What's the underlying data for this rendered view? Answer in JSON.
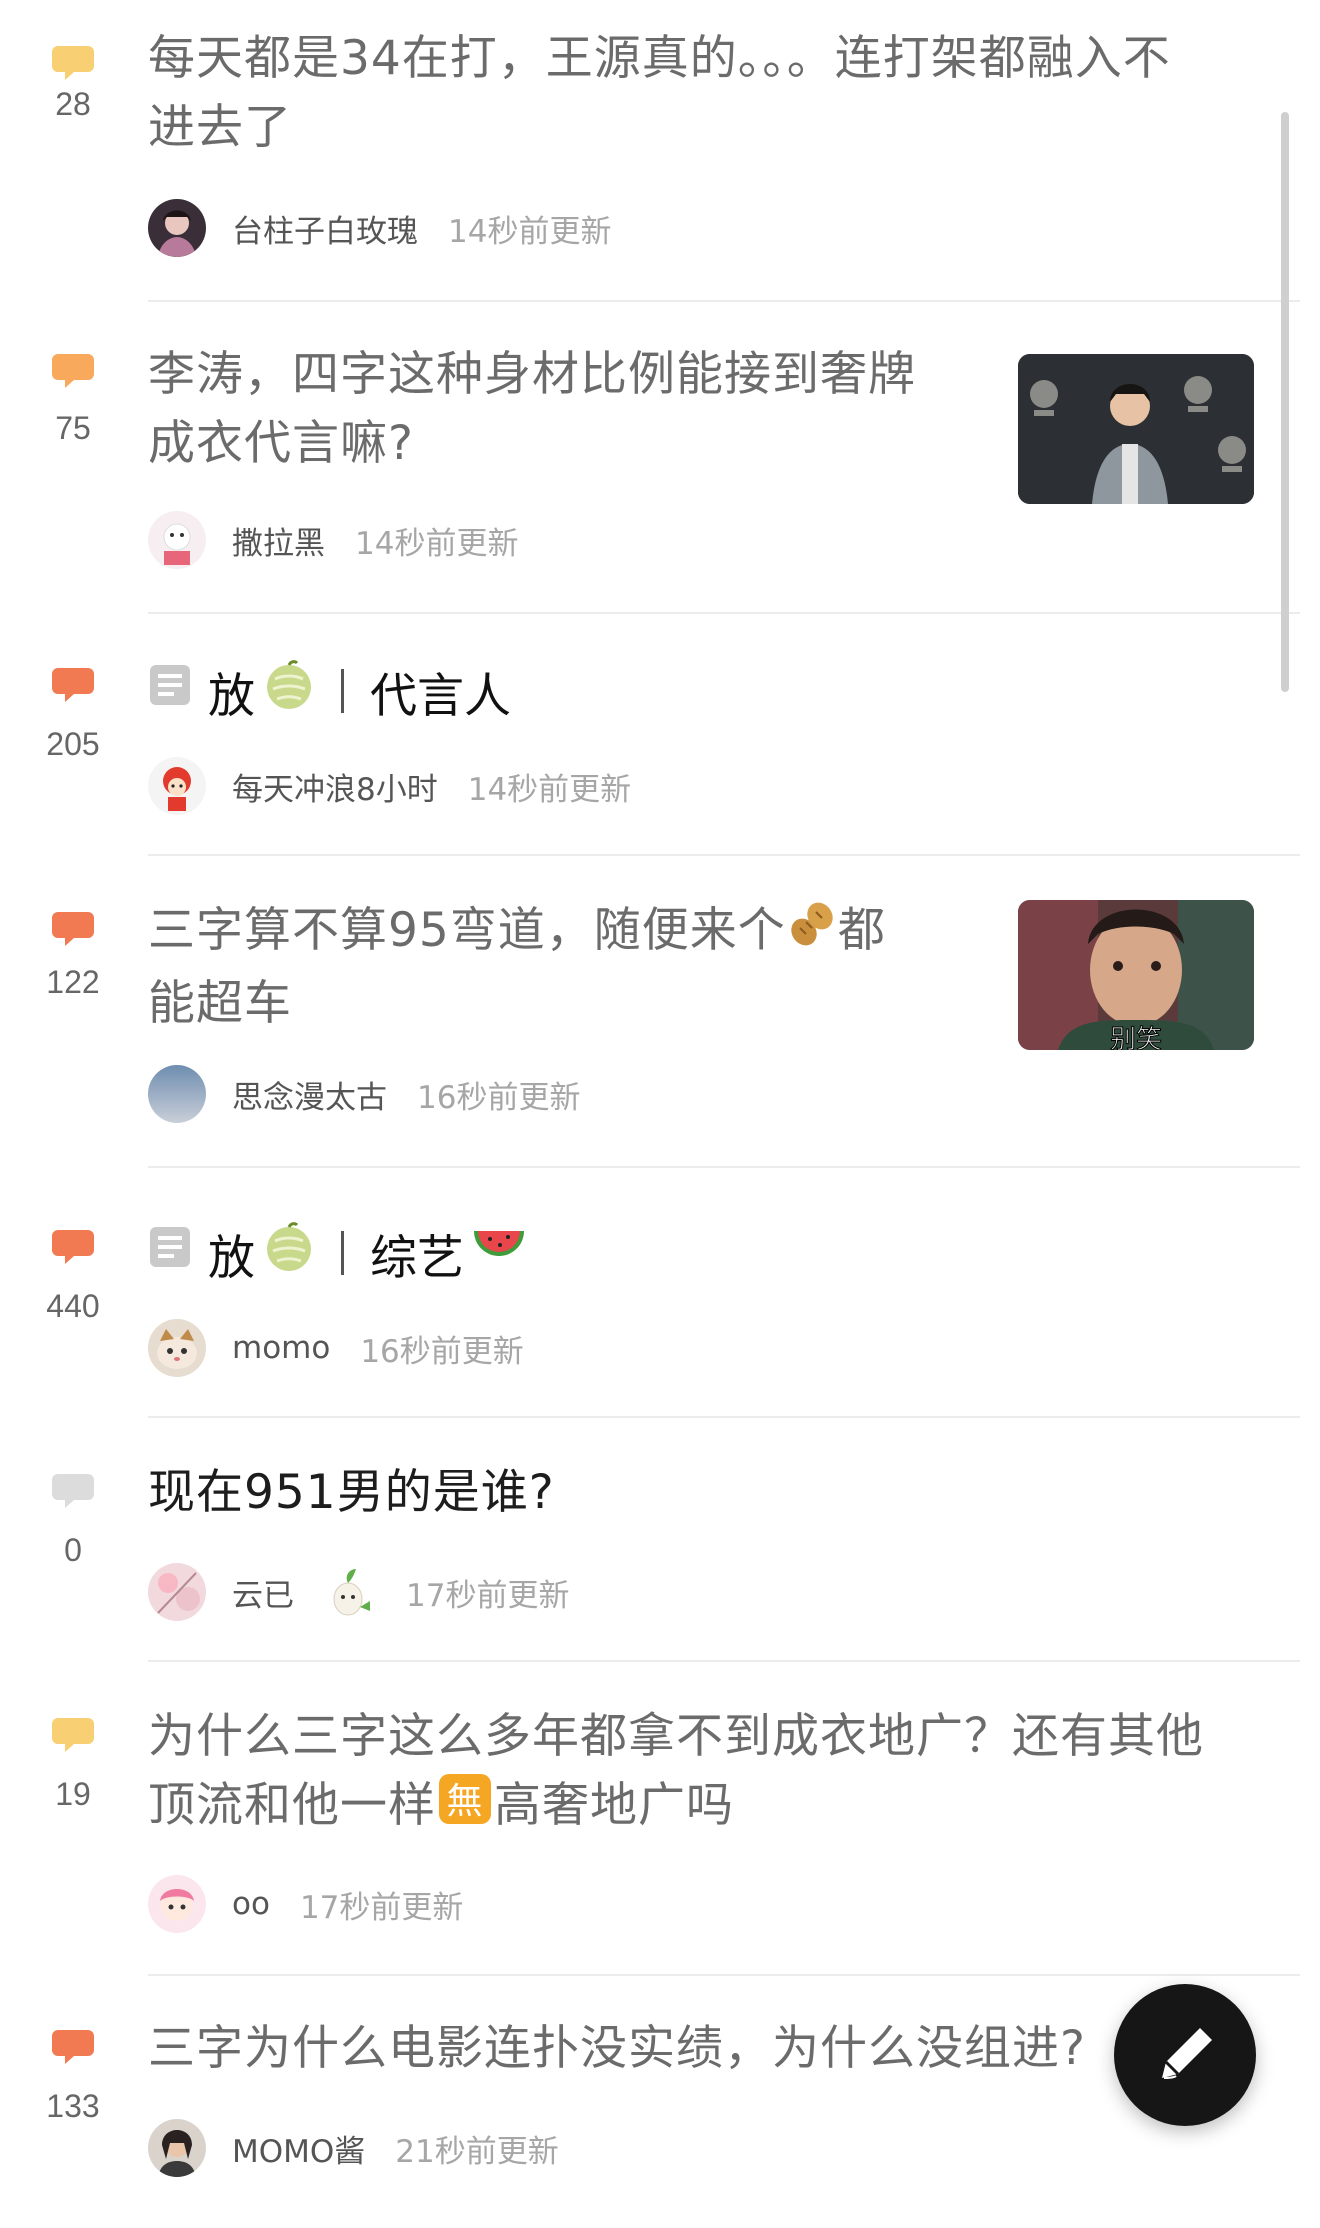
{
  "colors": {
    "bubble_hot": "#f27a52",
    "bubble_warm": "#f9a95c",
    "bubble_mild": "#f8cf72",
    "bubble_none": "#dcdcdc",
    "title_read": "#6b6b6b",
    "title_unread": "#1d1d1d",
    "time": "#a6a6a6",
    "fab": "#161616"
  },
  "posts": [
    {
      "comments": "28",
      "title_line1": "每天都是34在打，王源真的。。。连打架都融入不",
      "title_line2": "进去了",
      "author": "台柱子白玫瑰",
      "time": "14秒前更新"
    },
    {
      "comments": "75",
      "title_line1": "李涛，四字这种身材比例能接到奢牌",
      "title_line2": "成衣代言嘛?",
      "author": "撒拉黑",
      "time": "14秒前更新",
      "has_thumbnail": true
    },
    {
      "comments": "205",
      "tag_prefix": "放",
      "tag_emoji": "melon-emoji",
      "tag_label": "代言人",
      "author": "每天冲浪8小时",
      "time": "14秒前更新"
    },
    {
      "comments": "122",
      "title_line1_a": "三字算不算95弯道，随便来个",
      "title_line1_emoji": "peanut-emoji",
      "title_line1_b": "都",
      "title_line2": "能超车",
      "author": "思念漫太古",
      "time": "16秒前更新",
      "has_thumbnail": true,
      "thumbnail_caption": "别笑"
    },
    {
      "comments": "440",
      "tag_prefix": "放",
      "tag_emoji": "melon-emoji",
      "tag_label": "综艺",
      "tag_label_emoji": "watermelon-emoji",
      "author": "momo",
      "time": "16秒前更新"
    },
    {
      "comments": "0",
      "title_line1": "现在951男的是谁?",
      "author": "云已",
      "author_badge": "sprout-character-badge",
      "time": "17秒前更新"
    },
    {
      "comments": "19",
      "title_line1": "为什么三字这么多年都拿不到成衣地广？还有其他",
      "title_line2_a": "顶流和他一样",
      "title_line2_emoji": "無",
      "title_line2_b": "高奢地广吗",
      "author": "oo",
      "time": "17秒前更新"
    },
    {
      "comments": "133",
      "title_line1": "三字为什么电影连扑没实绩，为什么没组进?",
      "author": "MOMO酱",
      "time": "21秒前更新"
    }
  ],
  "fab": {
    "icon": "pencil-icon"
  }
}
